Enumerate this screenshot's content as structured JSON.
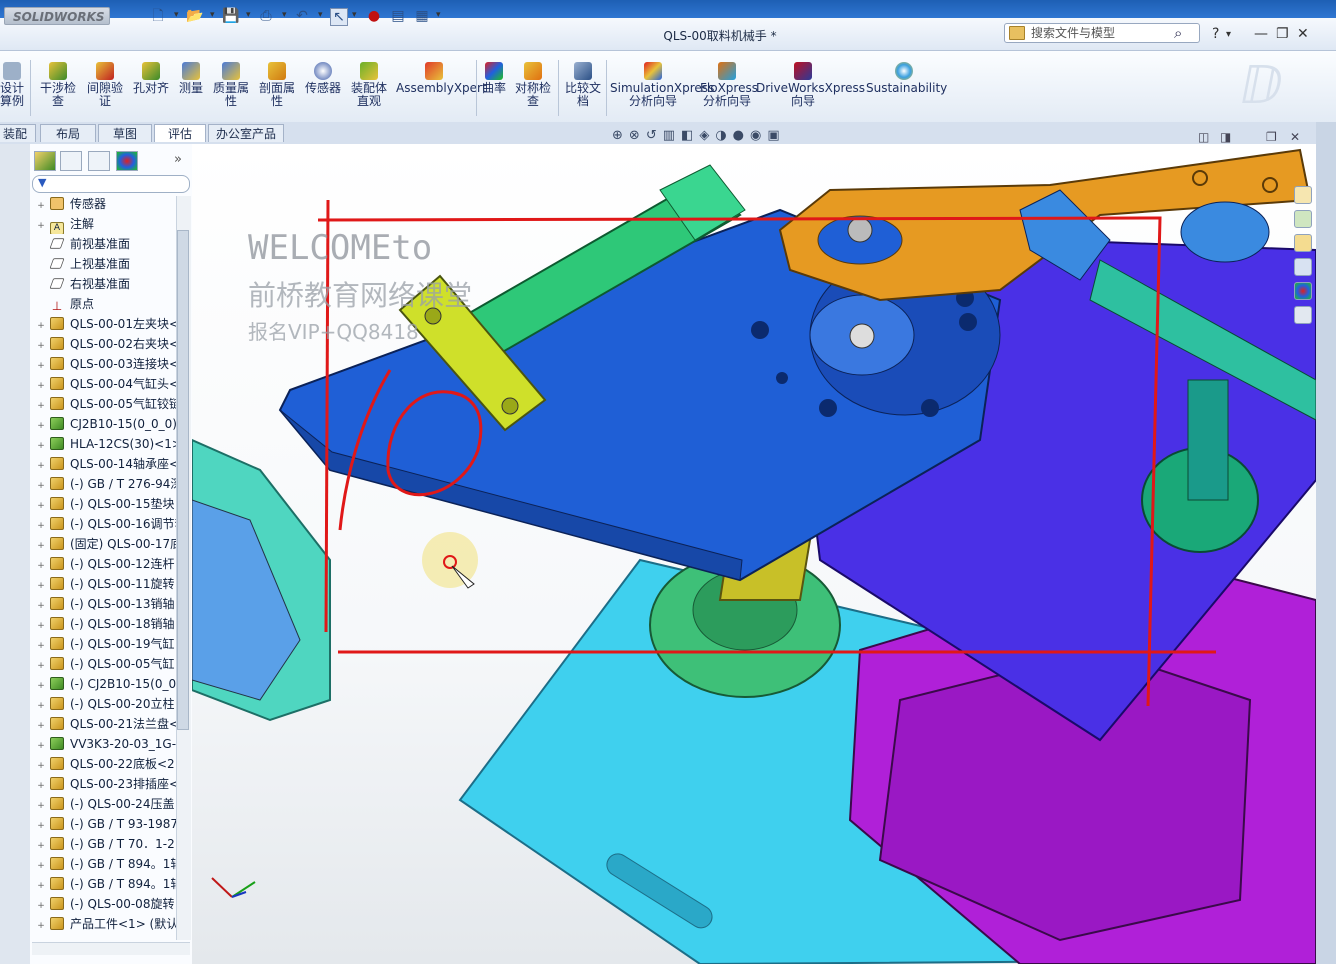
{
  "app": {
    "logo_text": "SOLIDWORKS",
    "document_title": "QLS-00取料机械手 *"
  },
  "search": {
    "placeholder": "搜索文件与模型"
  },
  "window_controls": {
    "minimize": "—",
    "restore": "❐",
    "close": "✕",
    "help": "?",
    "help_arrow": "▾"
  },
  "ribbon": {
    "items": [
      {
        "label": "设计算例",
        "icon": "design-study-icon"
      },
      {
        "label": "干涉检查",
        "icon": "interference-icon"
      },
      {
        "label": "间隙验证",
        "icon": "clearance-icon"
      },
      {
        "label": "孔对齐",
        "icon": "hole-align-icon"
      },
      {
        "label": "测量",
        "icon": "measure-icon"
      },
      {
        "label": "质量属性",
        "icon": "mass-props-icon"
      },
      {
        "label": "剖面属性",
        "icon": "section-props-icon"
      },
      {
        "label": "传感器",
        "icon": "sensor-icon"
      },
      {
        "label": "装配体直观",
        "icon": "assembly-visual-icon"
      },
      {
        "label": "AssemblyXpert",
        "icon": "assemblyxpert-icon"
      },
      {
        "label": "曲率",
        "icon": "curvature-icon"
      },
      {
        "label": "对称检查",
        "icon": "symmetry-icon"
      },
      {
        "label": "比较文档",
        "icon": "compare-icon"
      },
      {
        "label": "SimulationXpress 分析向导",
        "icon": "simulation-icon"
      },
      {
        "label": "FloXpress 分析向导",
        "icon": "floxpress-icon"
      },
      {
        "label": "DriveWorksXpress 向导",
        "icon": "driveworks-icon"
      },
      {
        "label": "Sustainability",
        "icon": "sustainability-icon"
      }
    ]
  },
  "tabs": [
    {
      "label": "装配体",
      "active": false
    },
    {
      "label": "布局",
      "active": false
    },
    {
      "label": "草图",
      "active": false
    },
    {
      "label": "评估",
      "active": true
    },
    {
      "label": "办公室产品",
      "active": false
    }
  ],
  "feature_tree": {
    "items": [
      {
        "label": "传感器",
        "icon": "sensor",
        "expand": "+"
      },
      {
        "label": "注解",
        "icon": "note",
        "expand": "+"
      },
      {
        "label": "前视基准面",
        "icon": "plane",
        "expand": ""
      },
      {
        "label": "上视基准面",
        "icon": "plane",
        "expand": ""
      },
      {
        "label": "右视基准面",
        "icon": "plane",
        "expand": ""
      },
      {
        "label": "原点",
        "icon": "origin",
        "expand": ""
      },
      {
        "label": "QLS-00-01左夹块<",
        "icon": "asm",
        "expand": "+"
      },
      {
        "label": "QLS-00-02右夹块<",
        "icon": "asm",
        "expand": "+"
      },
      {
        "label": "QLS-00-03连接块<",
        "icon": "asm",
        "expand": "+"
      },
      {
        "label": "QLS-00-04气缸头<",
        "icon": "asm",
        "expand": "+"
      },
      {
        "label": "QLS-00-05气缸铰链",
        "icon": "asm",
        "expand": "+"
      },
      {
        "label": "CJ2B10-15(0_0_0)-",
        "icon": "sub",
        "expand": "+"
      },
      {
        "label": "HLA-12CS(30)<1>",
        "icon": "sub",
        "expand": "+"
      },
      {
        "label": "QLS-00-14轴承座<",
        "icon": "asm",
        "expand": "+"
      },
      {
        "label": "(-) GB / T 276-94深",
        "icon": "asm",
        "expand": "+"
      },
      {
        "label": "(-) QLS-00-15垫块",
        "icon": "asm",
        "expand": "+"
      },
      {
        "label": "(-) QLS-00-16调节套<",
        "icon": "asm",
        "expand": "+"
      },
      {
        "label": "(固定) QLS-00-17底",
        "icon": "asm",
        "expand": "+"
      },
      {
        "label": "(-) QLS-00-12连杆",
        "icon": "asm",
        "expand": "+"
      },
      {
        "label": "(-) QLS-00-11旋转",
        "icon": "asm",
        "expand": "+"
      },
      {
        "label": "(-) QLS-00-13销轴",
        "icon": "asm",
        "expand": "+"
      },
      {
        "label": "(-) QLS-00-18销轴",
        "icon": "asm",
        "expand": "+"
      },
      {
        "label": "(-) QLS-00-19气缸",
        "icon": "asm",
        "expand": "+"
      },
      {
        "label": "(-) QLS-00-05气缸",
        "icon": "asm",
        "expand": "+"
      },
      {
        "label": "(-) CJ2B10-15(0_0_",
        "icon": "sub",
        "expand": "+"
      },
      {
        "label": "(-) QLS-00-20立柱",
        "icon": "asm",
        "expand": "+"
      },
      {
        "label": "QLS-00-21法兰盘<",
        "icon": "asm",
        "expand": "+"
      },
      {
        "label": "VV3K3-20-03_1G-",
        "icon": "sub",
        "expand": "+"
      },
      {
        "label": "QLS-00-22底板<2",
        "icon": "asm",
        "expand": "+"
      },
      {
        "label": "QLS-00-23排插座<",
        "icon": "asm",
        "expand": "+"
      },
      {
        "label": "(-) QLS-00-24压盖",
        "icon": "asm",
        "expand": "+"
      },
      {
        "label": "(-) GB / T 93-1987",
        "icon": "asm",
        "expand": "+"
      },
      {
        "label": "(-) GB / T 70．1-2",
        "icon": "asm",
        "expand": "+"
      },
      {
        "label": "(-) GB / T 894。1轴",
        "icon": "asm",
        "expand": "+"
      },
      {
        "label": "(-) GB / T 894。1轴",
        "icon": "asm",
        "expand": "+"
      },
      {
        "label": "(-) QLS-00-08旋转",
        "icon": "asm",
        "expand": "+"
      },
      {
        "label": "产品工件<1> (默认",
        "icon": "asm",
        "expand": "+"
      }
    ]
  },
  "watermark": {
    "line1": "WELCOMEto",
    "line2": "前桥教育网络课堂",
    "line3": "报名VIP+QQ8418"
  },
  "colors": {
    "plate_blue": "#1f5fd6",
    "orange_link": "#e69a22",
    "cyan_base": "#3fd0ee",
    "purple_block": "#b020d8",
    "green_flange": "#3ec078",
    "annotation_red": "#e01818"
  }
}
